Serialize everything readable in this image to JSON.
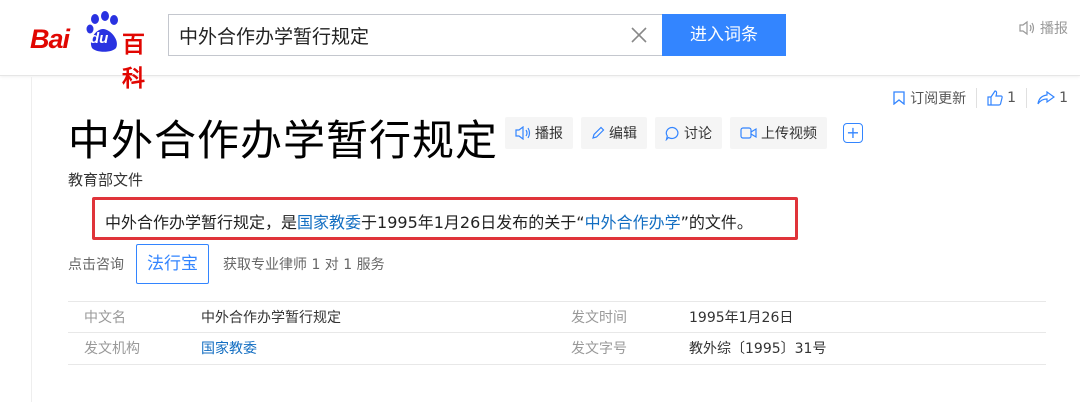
{
  "header": {
    "logo": {
      "bai": "Bai",
      "du": "du",
      "baike": "百科"
    },
    "search_value": "中外合作办学暂行规定",
    "enter_label": "进入词条",
    "report_label": "播报"
  },
  "actions": {
    "subscribe_label": "订阅更新",
    "like_count": "1",
    "share_count": "1"
  },
  "entry": {
    "title": "中外合作办学暂行规定",
    "tools": {
      "play": "播报",
      "edit": "编辑",
      "discuss": "讨论",
      "upload_video": "上传视频",
      "add": "+"
    },
    "subtitle": "教育部文件",
    "summary": {
      "part1": "中外合作办学暂行规定，是",
      "link1": "国家教委",
      "part2": "于1995年1月26日发布的关于“",
      "link2": "中外合作办学",
      "part3": "”的文件。"
    },
    "consult": {
      "prefix": "点击咨询",
      "badge": "法行宝",
      "suffix": "获取专业律师 1 对 1 服务"
    },
    "info": {
      "r1": {
        "k1": "中文名",
        "v1": "中外合作办学暂行规定",
        "k2": "发文时间",
        "v2": "1995年1月26日"
      },
      "r2": {
        "k1": "发文机构",
        "v1": "国家教委",
        "k2": "发文字号",
        "v2": "教外综〔1995〕31号"
      }
    }
  },
  "colors": {
    "brand_red": "#e10601",
    "brand_blue": "#3385ff",
    "link": "#136ec2",
    "highlight_border": "#e0343a"
  }
}
